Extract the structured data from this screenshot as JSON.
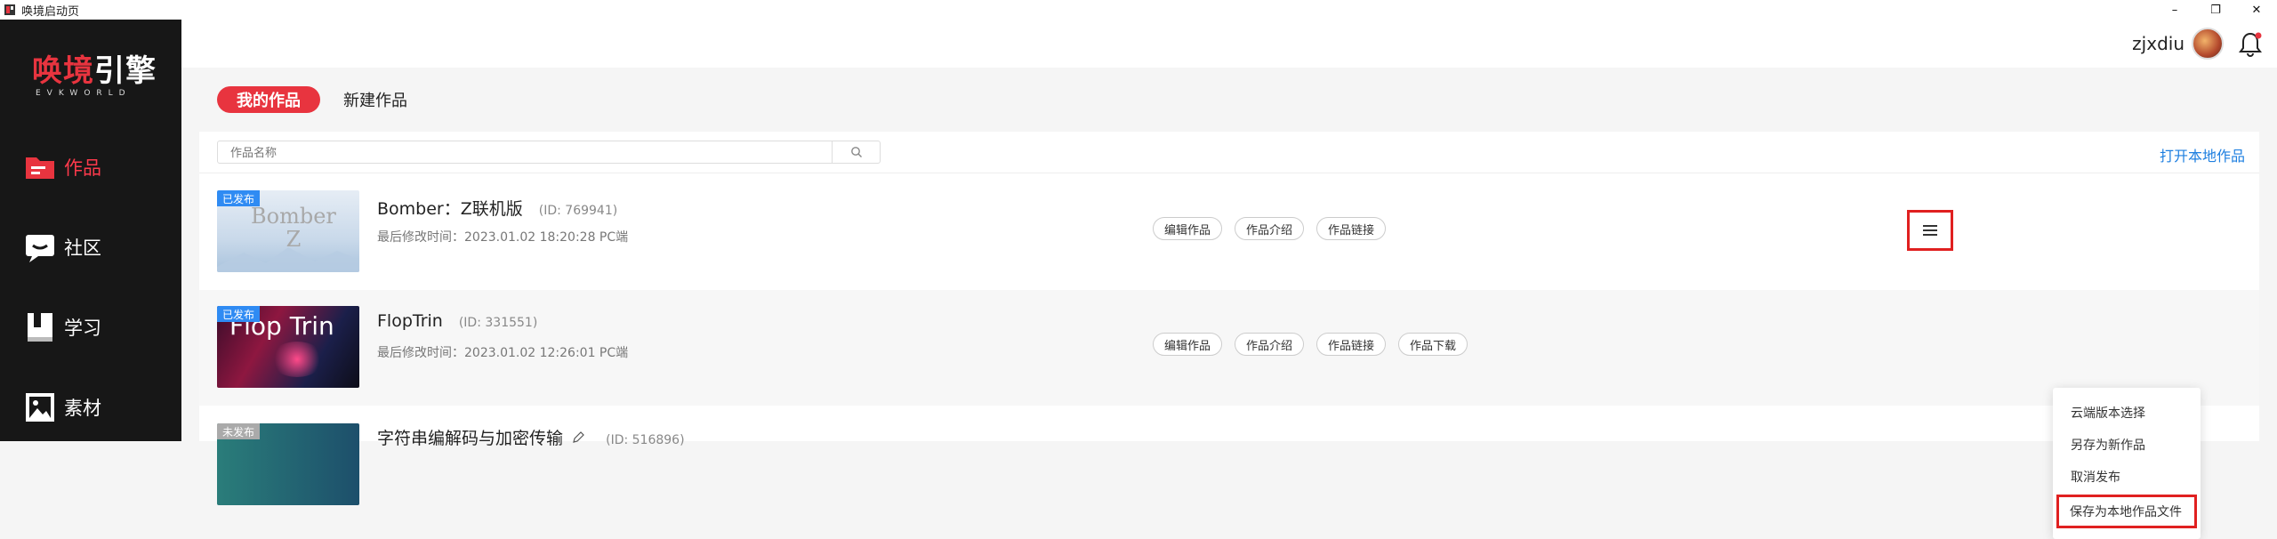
{
  "window": {
    "title": "唤境启动页",
    "min": "–",
    "restore": "❐",
    "close": "✕"
  },
  "sidebar": {
    "logo_main_a": "唤境",
    "logo_main_b": "引擎",
    "logo_sub": "EVKWORLD",
    "items": [
      {
        "label": "作品",
        "icon": "folder-icon",
        "active": true
      },
      {
        "label": "社区",
        "icon": "chat-icon"
      },
      {
        "label": "学习",
        "icon": "book-icon"
      },
      {
        "label": "素材",
        "icon": "image-icon"
      }
    ]
  },
  "header": {
    "username": "zjxdiu"
  },
  "tabs": [
    {
      "label": "我的作品",
      "active": true
    },
    {
      "label": "新建作品"
    }
  ],
  "search": {
    "placeholder": "作品名称"
  },
  "open_local": "打开本地作品",
  "works": [
    {
      "badge": "已发布",
      "title": "Bomber：Z联机版",
      "id": "(ID: 769941)",
      "meta": "最后修改时间：2023.01.02 18:20:28   PC端",
      "thumb_text": "Bomber\nZ",
      "actions": [
        "编辑作品",
        "作品介绍",
        "作品链接"
      ]
    },
    {
      "badge": "已发布",
      "title": "FlopTrin",
      "id": "(ID: 331551)",
      "meta": "最后修改时间：2023.01.02 12:26:01   PC端",
      "thumb_text": "Flop Trin",
      "actions": [
        "编辑作品",
        "作品介绍",
        "作品链接",
        "作品下载"
      ]
    },
    {
      "badge": "未发布",
      "title": "字符串编解码与加密传输",
      "id": "(ID: 516896)"
    }
  ],
  "dropdown": [
    "云端版本选择",
    "另存为新作品",
    "取消发布",
    "保存为本地作品文件"
  ],
  "colors": {
    "accent": "#e8343f",
    "link": "#1e7fe0",
    "badge_published": "#2f8bf3",
    "badge_draft": "#aaaaaa"
  }
}
